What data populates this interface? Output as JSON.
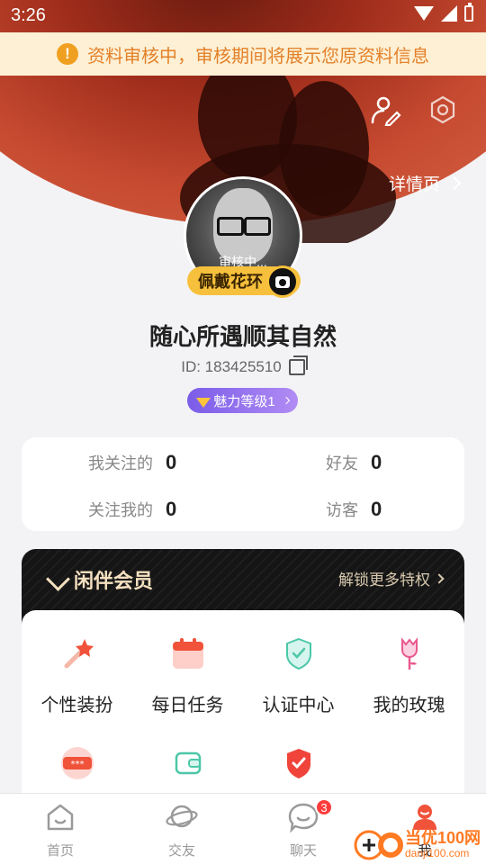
{
  "status_bar": {
    "time": "3:26"
  },
  "notice": {
    "text": "资料审核中，审核期间将展示您原资料信息",
    "icon": "warning-icon"
  },
  "header": {
    "detail_link": "详情页"
  },
  "profile": {
    "avatar_status": "审核中...",
    "wreath_button": "佩戴花环",
    "nickname": "随心所遇顺其自然",
    "id_label": "ID: 183425510",
    "charm_badge": "魅力等级1"
  },
  "stats": [
    {
      "label": "我关注的",
      "value": "0"
    },
    {
      "label": "好友",
      "value": "0"
    },
    {
      "label": "关注我的",
      "value": "0"
    },
    {
      "label": "访客",
      "value": "0"
    }
  ],
  "vip": {
    "title": "闲伴会员",
    "unlock": "解锁更多特权"
  },
  "features": [
    {
      "label": "个性装扮",
      "icon": "magic-wand-icon"
    },
    {
      "label": "每日任务",
      "icon": "calendar-icon"
    },
    {
      "label": "认证中心",
      "icon": "shield-check-icon"
    },
    {
      "label": "我的玫瑰",
      "icon": "rose-icon"
    },
    {
      "label": "",
      "icon": "password-card-icon"
    },
    {
      "label": "",
      "icon": "wallet-icon"
    },
    {
      "label": "",
      "icon": "security-shield-icon"
    }
  ],
  "bottom_nav": [
    {
      "label": "首页",
      "icon": "home-icon"
    },
    {
      "label": "交友",
      "icon": "planet-icon"
    },
    {
      "label": "聊天",
      "icon": "chat-icon",
      "badge": "3"
    },
    {
      "label": "我",
      "icon": "me-icon"
    }
  ],
  "watermark": {
    "text": "当优100网",
    "url": "danji100.com"
  },
  "colors": {
    "accent": "#f7c03c",
    "brand_red": "#c64a30",
    "notice_text": "#e3812a",
    "vip_gold": "#f5e0c0"
  }
}
